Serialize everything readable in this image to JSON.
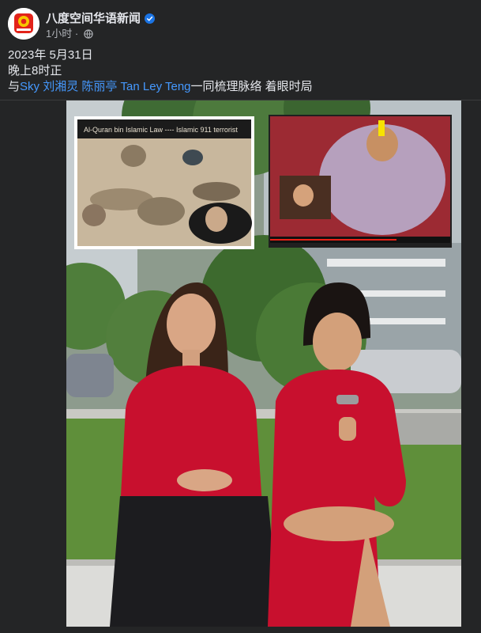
{
  "post": {
    "page_name": "八度空间华语新闻",
    "verified": true,
    "time": "1小时",
    "separator": "·",
    "audience_icon": "globe-icon",
    "date_line": "2023年 5月31日",
    "time_line": "晚上8时正",
    "intro_prefix": "与",
    "mention_1": "Sky 刘湘灵",
    "space": " ",
    "mention_2": "陈丽亭 Tan Ley Teng",
    "intro_suffix": "一同梳理脉络 着眼时局"
  },
  "media": {
    "left_inset_caption": "Al-Quran bin Islamic Law ---- Islamic 911 terrorist",
    "colors": {
      "background": "#242526",
      "text": "#e4e6eb",
      "meta": "#b0b3b8",
      "link": "#4599ff",
      "dress": "#c8102e"
    }
  }
}
